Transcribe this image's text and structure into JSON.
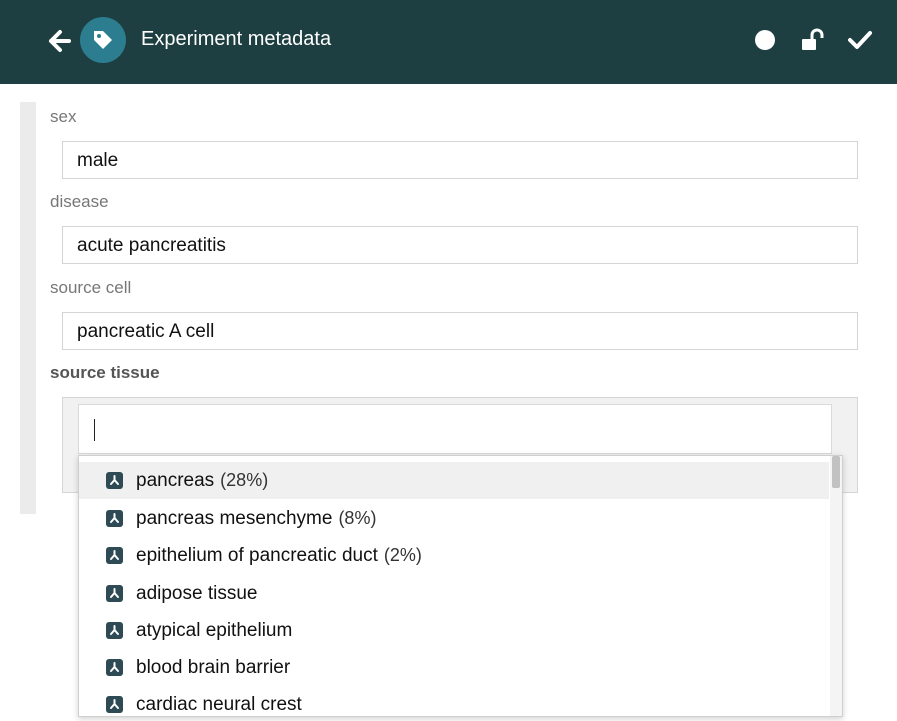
{
  "header": {
    "title": "Experiment metadata",
    "icons": {
      "back": "arrow-left-icon",
      "tag": "tag-icon",
      "status": "circle-icon",
      "lock": "unlock-icon",
      "confirm": "check-icon"
    },
    "background": "#1e3f41",
    "tag_circle_color": "#2c7d8f"
  },
  "fields": [
    {
      "label": "sex",
      "value": "male"
    },
    {
      "label": "disease",
      "value": "acute pancreatitis"
    },
    {
      "label": "source cell",
      "value": "pancreatic A cell"
    }
  ],
  "source_tissue": {
    "label": "source tissue",
    "input_value": ""
  },
  "dropdown": {
    "icon": "ontology-term-icon",
    "items": [
      {
        "label": "pancreas",
        "pct": "(28%)",
        "highlighted": true
      },
      {
        "label": "pancreas mesenchyme",
        "pct": "(8%)",
        "highlighted": false
      },
      {
        "label": "epithelium of pancreatic duct",
        "pct": "(2%)",
        "highlighted": false
      },
      {
        "label": "adipose tissue",
        "pct": "",
        "highlighted": false
      },
      {
        "label": "atypical epithelium",
        "pct": "",
        "highlighted": false
      },
      {
        "label": "blood brain barrier",
        "pct": "",
        "highlighted": false
      },
      {
        "label": "cardiac neural crest",
        "pct": "",
        "highlighted": false
      }
    ]
  }
}
